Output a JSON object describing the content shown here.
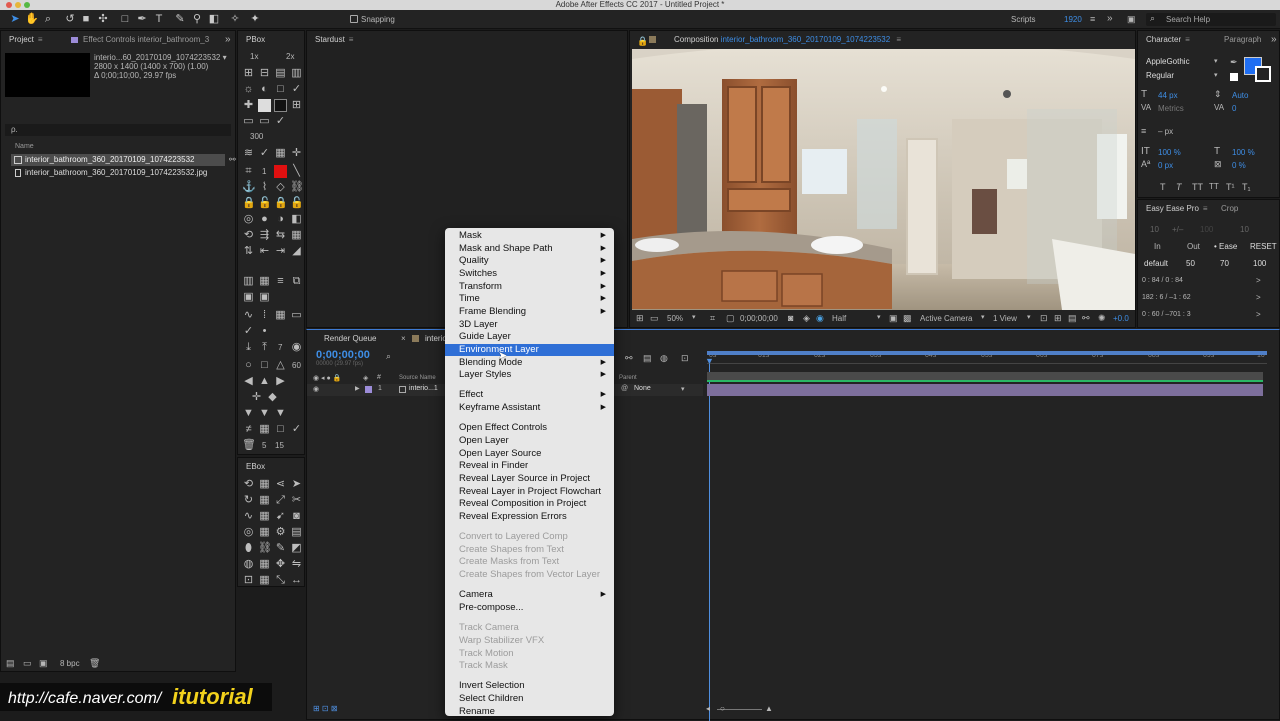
{
  "app": {
    "window_title": "Adobe After Effects CC 2017 - Untitled Project *"
  },
  "toolbar": {
    "snapping_label": "Snapping",
    "scripts_label": "Scripts",
    "workspace_value": "1920",
    "help_placeholder": "Search Help"
  },
  "project_panel": {
    "tab_project": "Project",
    "tab_effect_controls": "Effect Controls interior_bathroom_3",
    "selected_name": "interio...60_20170109_1074223532 ▾",
    "info_line1": "2800 x 1400  (1400 x 700) (1.00)",
    "info_line2": "Δ 0;00;10;00, 29.97 fps",
    "search_placeholder": "ρ.",
    "column_name": "Name",
    "items": [
      {
        "name": "interior_bathroom_360_20170109_1074223532",
        "type": "comp"
      },
      {
        "name": "interior_bathroom_360_20170109_1074223532.jpg",
        "type": "footage"
      }
    ],
    "bpc_label": "8 bpc"
  },
  "pbox": {
    "title": "PBox",
    "zoom_1x": "1x",
    "zoom_2x": "2x",
    "value_300": "300",
    "value_1": "1",
    "value_7": "7",
    "value_60": "60",
    "value_5": "5",
    "value_15": "15",
    "accent_red": "#e01010"
  },
  "ebox": {
    "title": "EBox"
  },
  "stardust": {
    "title": "Stardust"
  },
  "composition": {
    "tab_label": "Composition",
    "comp_name": "interior_bathroom_360_20170109_1074223532",
    "zoom": "50%",
    "timecode": "0;00;00;00",
    "resolution": "Half",
    "camera": "Active Camera",
    "views": "1 View",
    "exposure": "+0.0"
  },
  "timeline": {
    "tab_render_queue": "Render Queue",
    "tab_comp": "interio",
    "timecode": "0;00;00;00",
    "fps_line": "00000 (29.97 fps)",
    "col_source_name": "Source Name",
    "col_parent": "Parent",
    "layer_index": "1",
    "layer_name": "interio...1",
    "parent_value": "None",
    "ruler_marks": [
      "0s",
      "01s",
      "02s",
      "03s",
      "04s",
      "05s",
      "06s",
      "07s",
      "08s",
      "09s",
      "10"
    ]
  },
  "character_panel": {
    "tab_character": "Character",
    "tab_paragraph": "Paragraph",
    "font_family": "AppleGothic",
    "font_style": "Regular",
    "font_size": "44 px",
    "leading": "Auto",
    "kerning": "Metrics",
    "tracking": "0",
    "stroke_width": "– px",
    "vertical_scale": "100 %",
    "horizontal_scale": "100 %",
    "baseline_shift": "0 px",
    "tsume": "0 %",
    "style_buttons": [
      "T",
      "T",
      "TT",
      "TT",
      "T¹",
      "T₁"
    ],
    "fill_color": "#1f6ef2"
  },
  "easeease_panel": {
    "tab_easy_ease": "Easy Ease Pro",
    "tab_crop": "Crop",
    "val_left": "10",
    "val_pm": "+/–",
    "val_100": "100",
    "val_right": "10",
    "label_in": "In",
    "label_out": "Out",
    "label_ease": "Ease",
    "reset": "RESET",
    "preset": "default",
    "p1": "50",
    "p2": "70",
    "p3": "100",
    "line1": "0 : 84 / 0 : 84",
    "line2": "182 : 6 / –1 : 62",
    "line3": "0 : 60 / –701 : 3"
  },
  "context_menu": {
    "items": [
      {
        "label": "Mask",
        "sub": true,
        "state": "normal"
      },
      {
        "label": "Mask and Shape Path",
        "sub": true,
        "state": "normal"
      },
      {
        "label": "Quality",
        "sub": true,
        "state": "normal"
      },
      {
        "label": "Switches",
        "sub": true,
        "state": "normal"
      },
      {
        "label": "Transform",
        "sub": true,
        "state": "normal"
      },
      {
        "label": "Time",
        "sub": true,
        "state": "normal"
      },
      {
        "label": "Frame Blending",
        "sub": true,
        "state": "normal"
      },
      {
        "label": "3D Layer",
        "sub": false,
        "state": "normal"
      },
      {
        "label": "Guide Layer",
        "sub": false,
        "state": "normal"
      },
      {
        "label": "Environment Layer",
        "sub": false,
        "state": "highlighted"
      },
      {
        "label": "Blending Mode",
        "sub": true,
        "state": "normal"
      },
      {
        "label": "Layer Styles",
        "sub": true,
        "state": "normal"
      },
      {
        "label": "Effect",
        "sub": true,
        "state": "normal"
      },
      {
        "label": "Keyframe Assistant",
        "sub": true,
        "state": "normal"
      },
      {
        "label": "Open Effect Controls",
        "sub": false,
        "state": "normal"
      },
      {
        "label": "Open Layer",
        "sub": false,
        "state": "normal"
      },
      {
        "label": "Open Layer Source",
        "sub": false,
        "state": "normal"
      },
      {
        "label": "Reveal in Finder",
        "sub": false,
        "state": "normal"
      },
      {
        "label": "Reveal Layer Source in Project",
        "sub": false,
        "state": "normal"
      },
      {
        "label": "Reveal Layer in Project Flowchart",
        "sub": false,
        "state": "normal"
      },
      {
        "label": "Reveal Composition in Project",
        "sub": false,
        "state": "normal"
      },
      {
        "label": "Reveal Expression Errors",
        "sub": false,
        "state": "normal"
      },
      {
        "label": "Convert to Layered Comp",
        "sub": false,
        "state": "disabled"
      },
      {
        "label": "Create Shapes from Text",
        "sub": false,
        "state": "disabled"
      },
      {
        "label": "Create Masks from Text",
        "sub": false,
        "state": "disabled"
      },
      {
        "label": "Create Shapes from Vector Layer",
        "sub": false,
        "state": "disabled"
      },
      {
        "label": "Camera",
        "sub": true,
        "state": "normal"
      },
      {
        "label": "Pre-compose...",
        "sub": false,
        "state": "normal"
      },
      {
        "label": "Track Camera",
        "sub": false,
        "state": "disabled"
      },
      {
        "label": "Warp Stabilizer VFX",
        "sub": false,
        "state": "disabled"
      },
      {
        "label": "Track Motion",
        "sub": false,
        "state": "disabled"
      },
      {
        "label": "Track Mask",
        "sub": false,
        "state": "disabled"
      },
      {
        "label": "Invert Selection",
        "sub": false,
        "state": "normal"
      },
      {
        "label": "Select Children",
        "sub": false,
        "state": "normal"
      },
      {
        "label": "Rename",
        "sub": false,
        "state": "normal"
      }
    ]
  },
  "watermark": {
    "url": "http://cafe.naver.com/",
    "brand": "itutorial"
  }
}
